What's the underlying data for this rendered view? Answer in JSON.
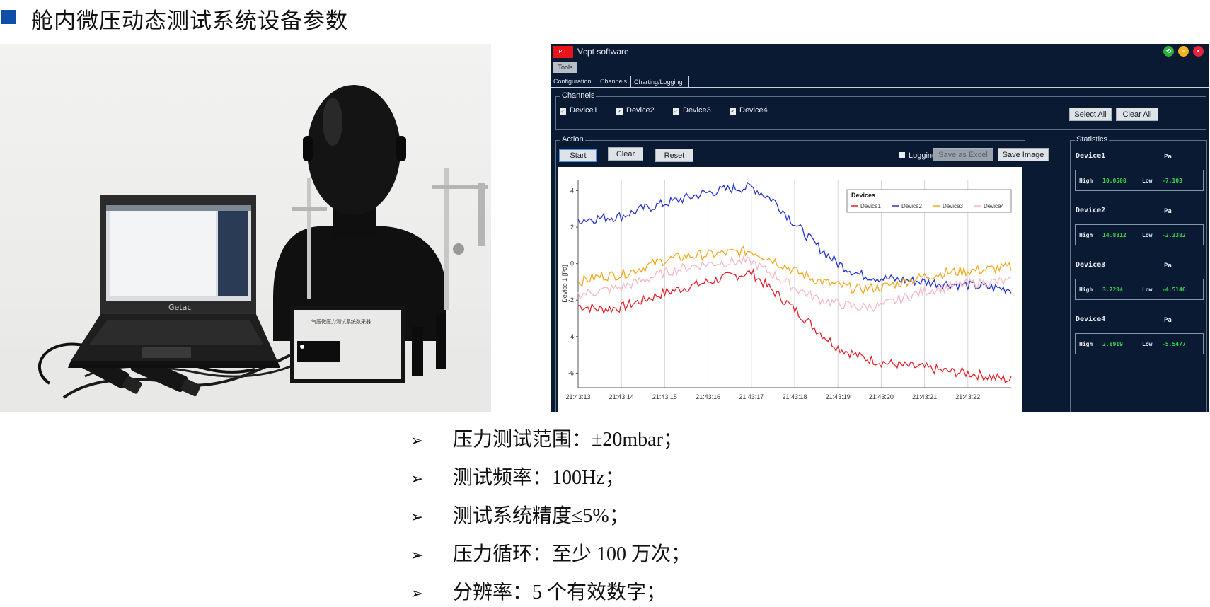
{
  "slide": {
    "title": "舱内微压动态测试系统设备参数",
    "bullet_color": "#0f4fa8"
  },
  "photo": {
    "laptop_brand": "Getac",
    "box_label": "气压微压力测试系统数采器"
  },
  "software": {
    "logo_text": "PT",
    "window_title": "Vcpt software",
    "menu": {
      "tools": "Tools"
    },
    "tabs": [
      "Configuration",
      "Channels",
      "Charting/Logging"
    ],
    "channels": {
      "legend": "Channels",
      "items": [
        "Device1",
        "Device2",
        "Device3",
        "Device4"
      ],
      "select_all": "Select All",
      "clear_all": "Clear All"
    },
    "action": {
      "legend": "Action",
      "start": "Start",
      "clear": "Clear",
      "reset": "Reset",
      "logging": "Logging",
      "save_excel": "Save as Excel",
      "save_image": "Save Image"
    },
    "statistics": {
      "legend": "Statistics",
      "high_label": "High",
      "low_label": "Low",
      "devices": [
        {
          "name": "Device1",
          "unit": "Pa",
          "high": "10.0508",
          "low": "-7.103"
        },
        {
          "name": "Device2",
          "unit": "Pa",
          "high": "14.8812",
          "low": "-2.3382"
        },
        {
          "name": "Device3",
          "unit": "Pa",
          "high": "3.7204",
          "low": "-4.5146"
        },
        {
          "name": "Device4",
          "unit": "Pa",
          "high": "2.8919",
          "low": "-5.5477"
        }
      ]
    }
  },
  "chart_data": {
    "type": "line",
    "title": "",
    "xlabel": "",
    "ylabel": "Device 1 [Pa]",
    "x_ticks": [
      "21:43:13",
      "21:43:14",
      "21:43:15",
      "21:43:16",
      "21:43:17",
      "21:43:18",
      "21:43:19",
      "21:43:20",
      "21:43:21",
      "21:43:22"
    ],
    "xlim": [
      0,
      10
    ],
    "ylim": [
      -6.8,
      4.6
    ],
    "y_ticks": [
      4,
      2,
      0,
      -2,
      -4,
      -6
    ],
    "grid": "vertical",
    "legend_title": "Devices",
    "legend_position": "top-right",
    "x": [
      0,
      0.5,
      1,
      1.5,
      2,
      2.5,
      3,
      3.5,
      4,
      4.5,
      5,
      5.5,
      6,
      6.5,
      7,
      7.5,
      8,
      8.5,
      9,
      9.5,
      10
    ],
    "series": [
      {
        "name": "Device1",
        "color": "#e8202a",
        "values": [
          -2.3,
          -2.5,
          -2.4,
          -2.0,
          -1.6,
          -1.3,
          -1.0,
          -0.7,
          -0.5,
          -1.5,
          -2.5,
          -3.6,
          -4.6,
          -5.1,
          -5.4,
          -5.6,
          -5.7,
          -5.9,
          -6.0,
          -6.2,
          -6.4
        ]
      },
      {
        "name": "Device2",
        "color": "#2233cc",
        "values": [
          2.4,
          2.5,
          2.6,
          3.0,
          3.3,
          3.6,
          3.9,
          4.1,
          4.2,
          3.5,
          2.2,
          1.0,
          0.0,
          -0.6,
          -0.8,
          -0.9,
          -1.0,
          -1.1,
          -1.2,
          -1.3,
          -1.4
        ]
      },
      {
        "name": "Device3",
        "color": "#f2a81d",
        "values": [
          -1.0,
          -0.7,
          -0.6,
          -0.2,
          0.2,
          0.4,
          0.5,
          0.6,
          0.7,
          0.2,
          -0.4,
          -0.9,
          -1.2,
          -1.4,
          -1.3,
          -1.0,
          -0.7,
          -0.5,
          -0.4,
          -0.3,
          -0.2
        ]
      },
      {
        "name": "Device4",
        "color": "#f4b9c4",
        "values": [
          -1.7,
          -1.5,
          -1.3,
          -0.9,
          -0.5,
          -0.2,
          0.0,
          0.1,
          0.1,
          -0.6,
          -1.3,
          -1.9,
          -2.2,
          -2.4,
          -2.3,
          -1.9,
          -1.5,
          -1.3,
          -1.1,
          -1.0,
          -1.0
        ]
      }
    ]
  },
  "specs": [
    "压力测试范围：±20mbar；",
    "测试频率：100Hz；",
    "测试系统精度≤5%；",
    "压力循环：至少 100 万次；",
    "分辨率：5 个有效数字；"
  ]
}
